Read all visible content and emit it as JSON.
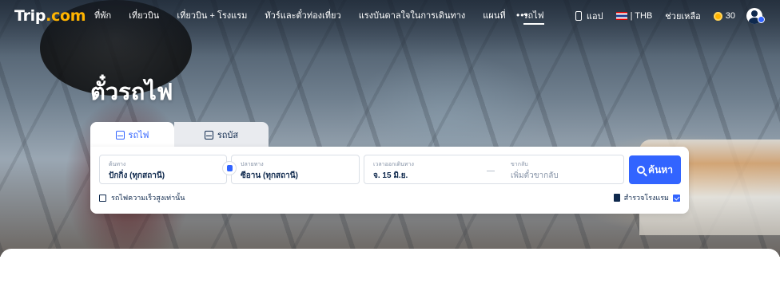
{
  "brand": {
    "logo_text": "Trip",
    "logo_suffix": ".com",
    "accent_color": "#3264ff"
  },
  "nav": {
    "links": [
      {
        "label": "ที่พัก",
        "active": false
      },
      {
        "label": "เที่ยวบิน",
        "active": false
      },
      {
        "label": "เที่ยวบิน + โรงแรม",
        "active": false
      },
      {
        "label": "ทัวร์และตั๋วท่องเที่ยว",
        "active": false
      },
      {
        "label": "แรงบันดาลใจในการเดินทาง",
        "active": false
      },
      {
        "label": "แผนที่",
        "active": false
      },
      {
        "label": "รถไฟ",
        "active": true
      }
    ],
    "more_label": "•••",
    "app_label": "แอป",
    "currency_label": "| THB",
    "help_label": "ช่วยเหลือ",
    "coins_label": "30"
  },
  "hero": {
    "title": "ตั๋วรถไฟ"
  },
  "tabs": [
    {
      "label": "รถไฟ",
      "icon": "train-icon",
      "active": true
    },
    {
      "label": "รถบัส",
      "icon": "bus-icon",
      "active": false
    }
  ],
  "search": {
    "origin": {
      "label": "ต้นทาง",
      "value": "ปักกิ่ง (ทุกสถานี)"
    },
    "destination": {
      "label": "ปลายทาง",
      "value": "ซีอาน (ทุกสถานี)"
    },
    "depart": {
      "label": "เวลาออกเดินทาง",
      "value": "จ. 15 มิ.ย."
    },
    "return": {
      "label": "ขากลับ",
      "placeholder": "เพิ่มตั๋วขากลับ"
    },
    "button_label": "ค้นหา",
    "highspeed_only_label": "รถไฟความเร็วสูงเท่านั้น",
    "explore_hotels_label": "สำรวจโรงแรม"
  }
}
